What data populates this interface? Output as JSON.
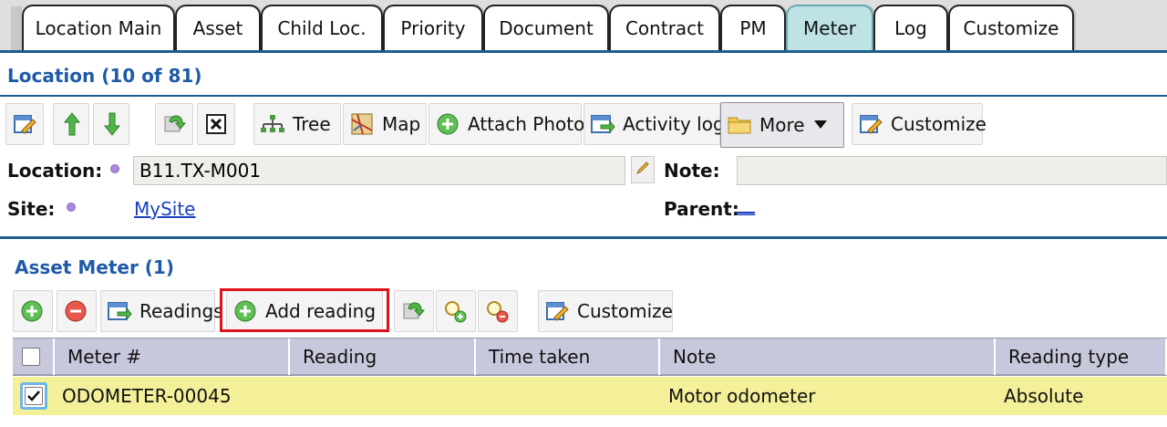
{
  "tabs": [
    {
      "label": "Location Main",
      "active": false
    },
    {
      "label": "Asset",
      "active": false
    },
    {
      "label": "Child Loc.",
      "active": false
    },
    {
      "label": "Priority",
      "active": false
    },
    {
      "label": "Document",
      "active": false
    },
    {
      "label": "Contract",
      "active": false
    },
    {
      "label": "PM",
      "active": false
    },
    {
      "label": "Meter",
      "active": true
    },
    {
      "label": "Log",
      "active": false
    },
    {
      "label": "Customize",
      "active": false
    }
  ],
  "header": {
    "title": "Location (10 of 81)"
  },
  "toolbar": {
    "tree": "Tree",
    "map": "Map",
    "attach_photo": "Attach Photo",
    "activity_log": "Activity log",
    "more": "More",
    "customize": "Customize"
  },
  "fields": {
    "location_label": "Location:",
    "location_value": "B11.TX-M001",
    "note_label": "Note:",
    "note_value": "",
    "site_label": "Site:",
    "site_value": "MySite",
    "parent_label": "Parent:",
    "parent_value": "__"
  },
  "asset_meter": {
    "title": "Asset Meter (1)",
    "toolbar": {
      "readings": "Readings",
      "add_reading": "Add reading",
      "customize": "Customize"
    },
    "columns": [
      "Meter #",
      "Reading",
      "Time taken",
      "Note",
      "Reading type"
    ],
    "rows": [
      {
        "checked": true,
        "meter": "ODOMETER-00045",
        "reading": "",
        "time_taken": "",
        "note": "Motor odometer",
        "reading_type": "Absolute"
      }
    ]
  },
  "colors": {
    "accent_blue": "#1e5aa8",
    "active_tab": "#bfe3e5",
    "selected_row": "#f4f09a",
    "highlight_box": "#e0131b"
  },
  "icons": {
    "toolbar": [
      "edit-icon",
      "arrow-up-icon",
      "arrow-down-icon",
      "refresh-icon",
      "close-icon",
      "tree-icon",
      "map-icon",
      "add-icon",
      "activity-log-icon",
      "folder-icon",
      "dropdown-arrow-icon",
      "customize-icon"
    ],
    "asset_toolbar": [
      "add-icon",
      "remove-icon",
      "readings-icon",
      "add-reading-icon",
      "refresh-icon",
      "zoom-in-icon",
      "zoom-out-icon",
      "customize-icon"
    ]
  }
}
